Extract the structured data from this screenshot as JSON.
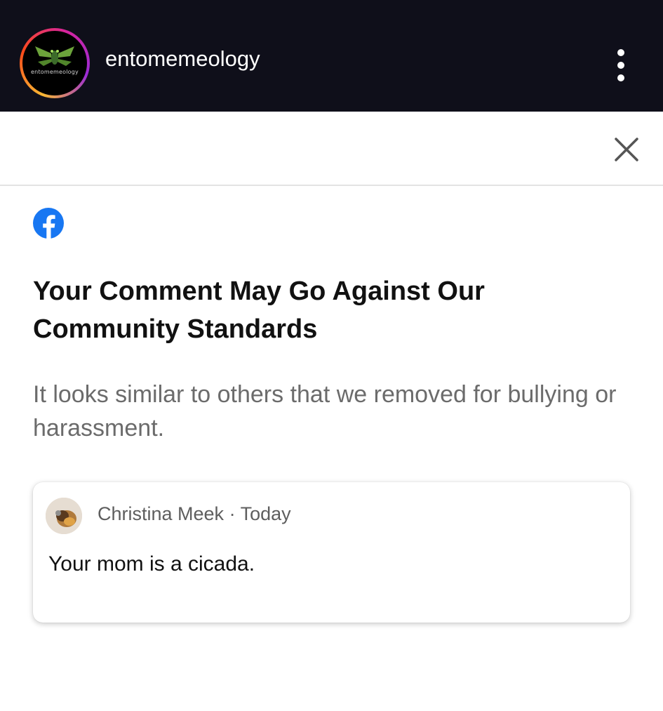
{
  "app": {
    "account_name": "entomemeology",
    "avatar_logo_text": "entomemeology",
    "avatar_ring_colors": [
      "#f7b733",
      "#fc4a1a",
      "#d6249f",
      "#9b2bd6"
    ],
    "topbar_color": "#0f0f1a"
  },
  "dialog": {
    "brand_icon": "facebook-icon",
    "brand_color": "#1877f2",
    "headline": "Your Comment May Go Against Our Community Standards",
    "explanation": "It looks similar to others that we removed for bullying or harassment.",
    "close_icon": "close-icon"
  },
  "comment": {
    "author": "Christina Meek",
    "separator": "·",
    "time": "Today",
    "text": "Your mom is a cicada."
  }
}
